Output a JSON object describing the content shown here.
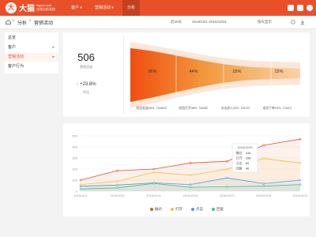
{
  "header": {
    "logo_badge": "大",
    "logo_text": "大猫",
    "logo_domain": "bigcat.com",
    "logo_tagline": "在线分析系统",
    "nav": [
      {
        "label": "客户 ▾"
      },
      {
        "label": "营销活动 ▾"
      },
      {
        "label": "分析"
      }
    ]
  },
  "breadcrumb": {
    "items": [
      "分析",
      "营销活动"
    ],
    "sep": ">",
    "filters": {
      "range": "近30天",
      "dates": "2016/10/1-2016/10/31",
      "display": "按天显示"
    }
  },
  "sidebar": {
    "items": [
      {
        "label": "总览"
      },
      {
        "label": "客户"
      },
      {
        "label": "营销活动"
      },
      {
        "label": "客户行为"
      }
    ]
  },
  "kpi": {
    "value": "506",
    "label": "营销活动",
    "change": "+23.8%",
    "change_label": "环比"
  },
  "funnel": {
    "stages": [
      {
        "pct": "95%",
        "label": "短信发送95%（10563）"
      },
      {
        "pct": "44%",
        "label": "短信打开38%（3498）"
      },
      {
        "pct": "25%",
        "label": "点击进入25%（2676）"
      },
      {
        "pct": "15%",
        "label": "成功下单15%（1340）"
      }
    ]
  },
  "chart_data": {
    "type": "line",
    "categories": [
      "2016/10/1",
      "2016/10/6",
      "2016/10/11",
      "2016/10/16",
      "2016/10/21",
      "2016/10/26",
      "2016/10/31"
    ],
    "ylim": [
      0,
      500
    ],
    "yticks": [
      "500",
      "400",
      "300",
      "200",
      "100",
      "0"
    ],
    "series": [
      {
        "name": "触达",
        "color": "#e8502a",
        "values": [
          100,
          185,
          200,
          255,
          270,
          415,
          470
        ]
      },
      {
        "name": "打开",
        "color": "#f5c233",
        "values": [
          60,
          90,
          170,
          145,
          200,
          296,
          255
        ]
      },
      {
        "name": "点击",
        "color": "#4a9de3",
        "values": [
          45,
          55,
          75,
          60,
          120,
          69,
          100
        ]
      },
      {
        "name": "回复",
        "color": "#3fbf9a",
        "values": [
          20,
          30,
          70,
          35,
          40,
          46,
          60
        ]
      }
    ],
    "tooltip": {
      "date": "2016/10/25",
      "rows": [
        {
          "name": "触达",
          "value": "415"
        },
        {
          "name": "打开",
          "value": "296"
        },
        {
          "name": "点击",
          "value": "69"
        },
        {
          "name": "回复",
          "value": "46"
        }
      ]
    }
  },
  "colors": {
    "brand": "#e8502a",
    "positive": "#2aa876"
  }
}
